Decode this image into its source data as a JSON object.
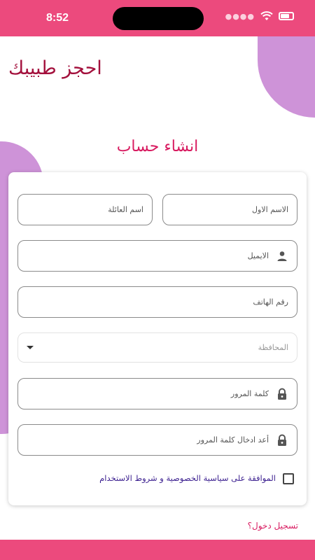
{
  "status": {
    "time": "8:52"
  },
  "app": {
    "title": "احجز طبيبك"
  },
  "page": {
    "title": "انشاء حساب"
  },
  "form": {
    "first_name_placeholder": "الاسم الاول",
    "last_name_placeholder": "اسم العائلة",
    "email_placeholder": "الايميل",
    "phone_placeholder": "رقم الهاتف",
    "governorate_placeholder": "المحافظة",
    "password_placeholder": "كلمة المرور",
    "confirm_password_placeholder": "أعد ادخال كلمة المرور",
    "agree_label": "الموافقة على سياسية الخصوصية و شروط الاستخدام",
    "agree_checked": false
  },
  "footer": {
    "login_link": "تسجيل دخول؟"
  },
  "colors": {
    "accent": "#ec4a7d",
    "title": "#a3103c",
    "deco": "#ce93d8",
    "link": "#d81b60"
  },
  "icons": [
    "person-icon",
    "lock-icon",
    "dropdown-arrow-icon",
    "wifi-icon",
    "battery-icon"
  ]
}
